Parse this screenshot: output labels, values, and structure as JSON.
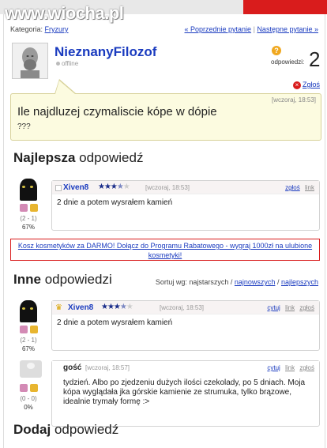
{
  "watermark": "www.wiocha.pl",
  "category": {
    "label": "Kategoria:",
    "value": "Fryzury"
  },
  "nav": {
    "prev": "« Poprzednie pytanie",
    "sep": "|",
    "next": "Następne pytanie »"
  },
  "user": {
    "name": "NieznanyFilozof",
    "status": "offline"
  },
  "answers_badge": {
    "label": "odpowiedzi:",
    "count": "2",
    "icon": "?"
  },
  "report_link": "Zgłoś",
  "question": {
    "time": "[wczoraj, 18:53]",
    "title": "Ile najdluzej czymaliscie kópe w dópie",
    "body": "???"
  },
  "best": {
    "heading_bold": "Najlepsza",
    "heading_rest": "odpowiedź",
    "author": "Xiven8",
    "stars_on": "★★★",
    "stars_half": "★",
    "stars_off": "★",
    "time": "[wczoraj, 18:53]",
    "actions": {
      "report": "zgłoś",
      "link": "link"
    },
    "text": "2 dnie a potem wysrałem kamień",
    "votes": {
      "score": "(2 - 1)",
      "pct": "67%"
    }
  },
  "promo": {
    "text": "Kosz kosmetyków za DARMO! Dołącz do Programu Rabatowego - wygraj 1000zł na ulubione kosmetyki!"
  },
  "others": {
    "heading_bold": "Inne",
    "heading_rest": "odpowiedzi",
    "sort_label": "Sortuj wg: najstarszych /",
    "sort_newest": "najnowszych",
    "sort_sep": "/",
    "sort_best": "najlepszych"
  },
  "answers": [
    {
      "author": "Xiven8",
      "stars_on": "★★★",
      "stars_half": "★",
      "stars_off": "★",
      "time": "[wczoraj, 18:53]",
      "actions": {
        "quote": "cytuj",
        "link": "link",
        "report": "zgłoś"
      },
      "text": "2 dnie a potem wysrałem kamień",
      "votes": {
        "score": "(2 - 1)",
        "pct": "67%"
      }
    },
    {
      "author": "gość",
      "time": "[wczoraj, 18:57]",
      "actions": {
        "quote": "cytuj",
        "link": "link",
        "report": "zgłoś"
      },
      "text": "tydzień. Albo po zjedzeniu dużych ilości czekolady, po 5 dniach. Moja kópa wyglądała jka górskie kamienie ze strumuka, tylko brązowe, idealnie trymały formę :>",
      "votes": {
        "score": "(0 - 0)",
        "pct": "0%"
      }
    }
  ],
  "add": {
    "heading_bold": "Dodaj",
    "heading_rest": "odpowiedź"
  }
}
